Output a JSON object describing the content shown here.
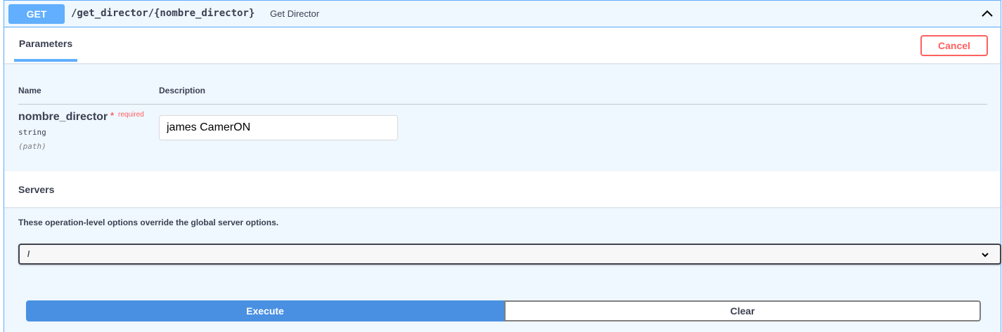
{
  "operation": {
    "method": "GET",
    "path": "/get_director/{nombre_director}",
    "description": "Get Director",
    "method_color": "#61affe"
  },
  "parameters": {
    "tab_label": "Parameters",
    "cancel_label": "Cancel",
    "col_name": "Name",
    "col_description": "Description",
    "items": [
      {
        "name": "nombre_director",
        "required_star": "*",
        "required_label": "required",
        "type": "string",
        "in": "(path)",
        "value": "james CamerON"
      }
    ]
  },
  "servers": {
    "title": "Servers",
    "note": "These operation-level options override the global server options.",
    "selected": "/"
  },
  "actions": {
    "execute_label": "Execute",
    "clear_label": "Clear",
    "execute_color": "#4990e2"
  },
  "icons": {
    "collapse": "chevron-up-icon",
    "select": "chevron-down-icon"
  }
}
